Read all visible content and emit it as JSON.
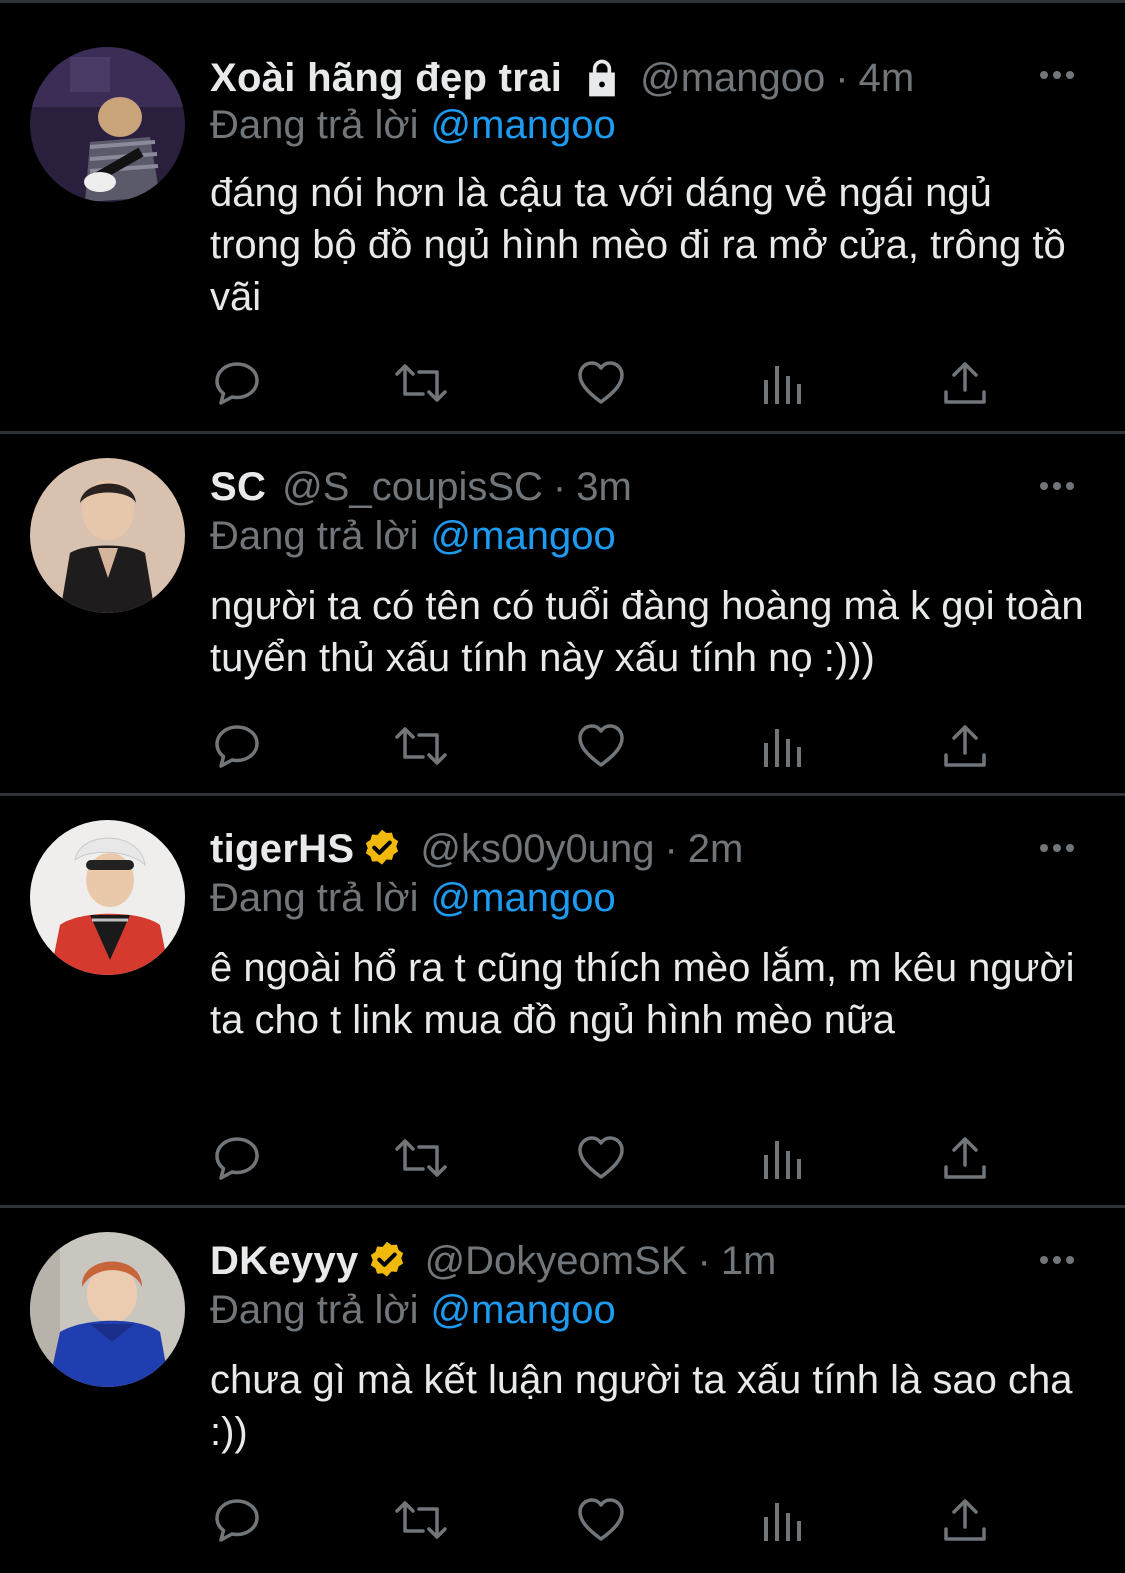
{
  "accent_color": "#1d9bf0",
  "verified_color": "#f0b90b",
  "reply_prefix": "Đang trả lời",
  "tweets": [
    {
      "name": "Xoài hãng đẹp trai",
      "handle": "@mangoo",
      "dot": "·",
      "time": "4m",
      "badge": "lock-icon",
      "reply_to": "@mangoo",
      "text": "đáng nói hơn là cậu ta với dáng vẻ ngái ngủ trong bộ đồ ngủ hình mèo đi ra mở cửa, trông tồ vãi"
    },
    {
      "name": "SC",
      "handle": "@S_coupisSC",
      "dot": "·",
      "time": "3m",
      "badge": "",
      "reply_to": "@mangoo",
      "text": "người ta có tên có tuổi đàng hoàng mà k gọi toàn tuyển thủ xấu tính này xấu tính nọ :)))"
    },
    {
      "name": "tigerHS",
      "handle": "@ks00y0ung",
      "dot": "·",
      "time": "2m",
      "badge": "verified-icon",
      "reply_to": "@mangoo",
      "text": "ê ngoài hổ ra t cũng thích mèo lắm, m kêu người ta cho t link mua đồ ngủ hình mèo nữa"
    },
    {
      "name": "DKeyyy",
      "handle": "@DokyeomSK",
      "dot": "·",
      "time": "1m",
      "badge": "verified-icon",
      "reply_to": "@mangoo",
      "text": "chưa gì mà kết luận người ta xấu tính là sao cha :))"
    }
  ]
}
